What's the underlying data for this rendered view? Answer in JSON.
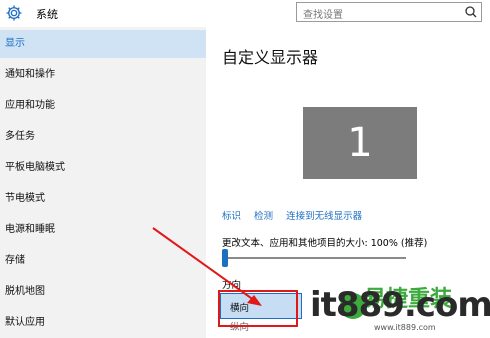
{
  "header": {
    "title": "系统",
    "search_placeholder": "查找设置"
  },
  "sidebar": {
    "items": [
      {
        "label": "显示",
        "active": true
      },
      {
        "label": "通知和操作"
      },
      {
        "label": "应用和功能"
      },
      {
        "label": "多任务"
      },
      {
        "label": "平板电脑模式"
      },
      {
        "label": "节电模式"
      },
      {
        "label": "电源和睡眠"
      },
      {
        "label": "存储"
      },
      {
        "label": "脱机地图"
      },
      {
        "label": "默认应用"
      }
    ]
  },
  "main": {
    "title": "自定义显示器",
    "monitor_number": "1",
    "links": {
      "identify": "标识",
      "detect": "检测",
      "wireless": "连接到无线显示器"
    },
    "scale_label": "更改文本、应用和其他项目的大小: 100% (推荐)",
    "scale_level_percent": 0,
    "orientation_label": "方向",
    "orientation_selected": "横向",
    "orientation_option2": "纵向"
  },
  "watermark": {
    "brand": "it889",
    "tld": ".com",
    "cn": "易捷重装",
    "url": "www.it889.com"
  },
  "colors": {
    "accent": "#1f6fc0",
    "sidebar_bg": "#f2f2f2",
    "active_bg": "#cfe3f5",
    "annotation": "#e01818",
    "watermark_green": "#3caa3c"
  }
}
